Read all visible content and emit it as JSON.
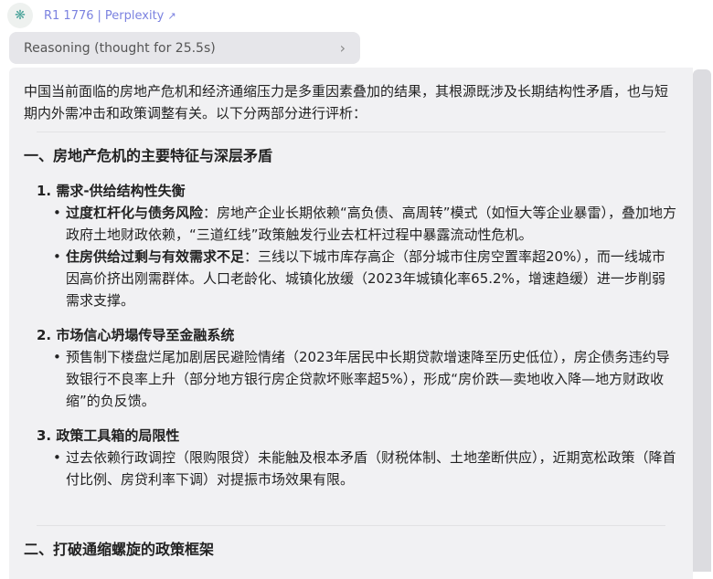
{
  "header": {
    "model": "R1 1776",
    "provider": "Perplexity"
  },
  "reasoning": {
    "label": "Reasoning (thought for 25.5s)"
  },
  "content": {
    "intro": "中国当前面临的房地产危机和经济通缩压力是多重因素叠加的结果，其根源既涉及长期结构性矛盾，也与短期内外需冲击和政策调整有关。以下分两部分进行评析：",
    "section1": {
      "title": "一、房地产危机的主要特征与深层矛盾",
      "items": [
        {
          "title": "1. 需求-供给结构性失衡",
          "bullets": [
            {
              "bold": "过度杠杆化与债务风险",
              "text": "：房地产企业长期依赖“高负债、高周转”模式（如恒大等企业暴雷），叠加地方政府土地财政依赖，“三道红线”政策触发行业去杠杆过程中暴露流动性危机。"
            },
            {
              "bold": "住房供给过剩与有效需求不足",
              "text": "：三线以下城市库存高企（部分城市住房空置率超20%），而一线城市因高价挤出刚需群体。人口老龄化、城镇化放缓（2023年城镇化率65.2%，增速趋缓）进一步削弱需求支撑。"
            }
          ]
        },
        {
          "title": "2. 市场信心坍塌传导至金融系统",
          "bullets": [
            {
              "bold": "",
              "text": "预售制下楼盘烂尾加剧居民避险情绪（2023年居民中长期贷款增速降至历史低位），房企债务违约导致银行不良率上升（部分地方银行房企贷款坏账率超5%），形成“房价跌—卖地收入降—地方财政收缩”的负反馈。"
            }
          ]
        },
        {
          "title": "3. 政策工具箱的局限性",
          "bullets": [
            {
              "bold": "",
              "text": "过去依赖行政调控（限购限贷）未能触及根本矛盾（财税体制、土地垄断供应），近期宽松政策（降首付比例、房贷利率下调）对提振市场效果有限。"
            }
          ]
        }
      ]
    },
    "section2": {
      "title": "二、打破通缩螺旋的政策框架"
    }
  }
}
